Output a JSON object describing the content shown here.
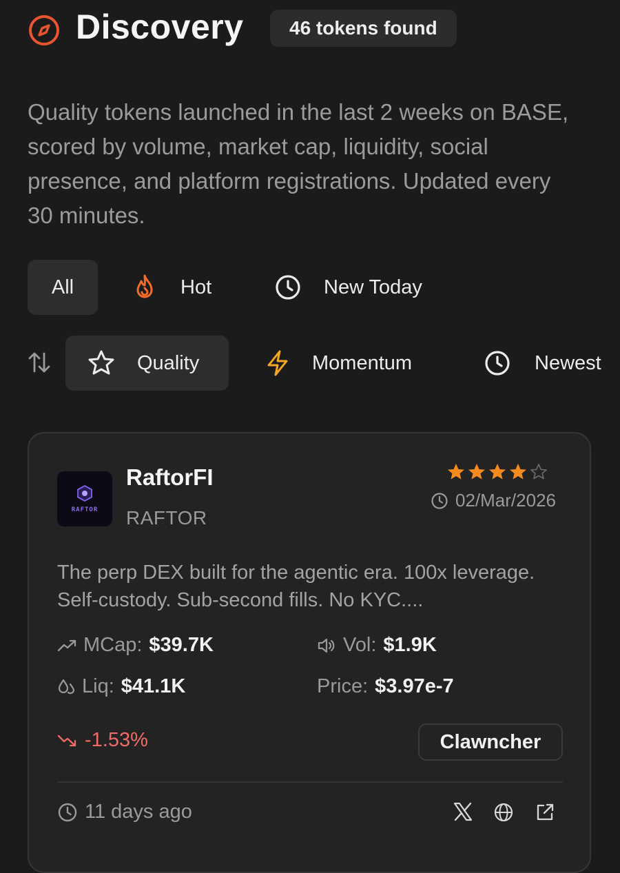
{
  "header": {
    "title": "Discovery",
    "badge": "46 tokens found",
    "icon": "compass-icon",
    "accent_color": "#e8552e"
  },
  "description": "Quality tokens launched in the last 2 weeks on BASE, scored by volume, market cap, liquidity, social presence, and platform registrations. Updated every 30 minutes.",
  "filters": [
    {
      "label": "All",
      "icon": "",
      "active": true
    },
    {
      "label": "Hot",
      "icon": "flame-icon",
      "active": false
    },
    {
      "label": "New Today",
      "icon": "clock-icon",
      "active": false
    }
  ],
  "sort": {
    "icon": "sort-arrows-icon",
    "options": [
      {
        "label": "Quality",
        "icon": "star-icon",
        "active": true
      },
      {
        "label": "Momentum",
        "icon": "lightning-icon",
        "active": false
      },
      {
        "label": "Newest",
        "icon": "clock-icon",
        "active": false
      }
    ]
  },
  "token": {
    "name": "RaftorFI",
    "symbol": "RAFTOR",
    "avatar_text": "RAFTOR",
    "rating": 4,
    "rating_max": 5,
    "launch_date": "02/Mar/2026",
    "description": "The perp DEX built for the agentic era. 100x leverage. Self-custody. Sub-second fills. No KYC....",
    "stats": {
      "mcap_label": "MCap:",
      "mcap": "$39.7K",
      "vol_label": "Vol:",
      "vol": "$1.9K",
      "liq_label": "Liq:",
      "liq": "$41.1K",
      "price_label": "Price:",
      "price": "$3.97e-7"
    },
    "change": "-1.53%",
    "change_color": "#ee6b66",
    "platform": "Clawncher",
    "age": "11 days ago",
    "links": [
      "x-icon",
      "globe-icon",
      "external-link-icon"
    ]
  },
  "colors": {
    "background": "#1b1b1b",
    "card": "#232323",
    "star": "#f58b1f",
    "flame": "#f26b2a",
    "lightning": "#f5a623"
  }
}
